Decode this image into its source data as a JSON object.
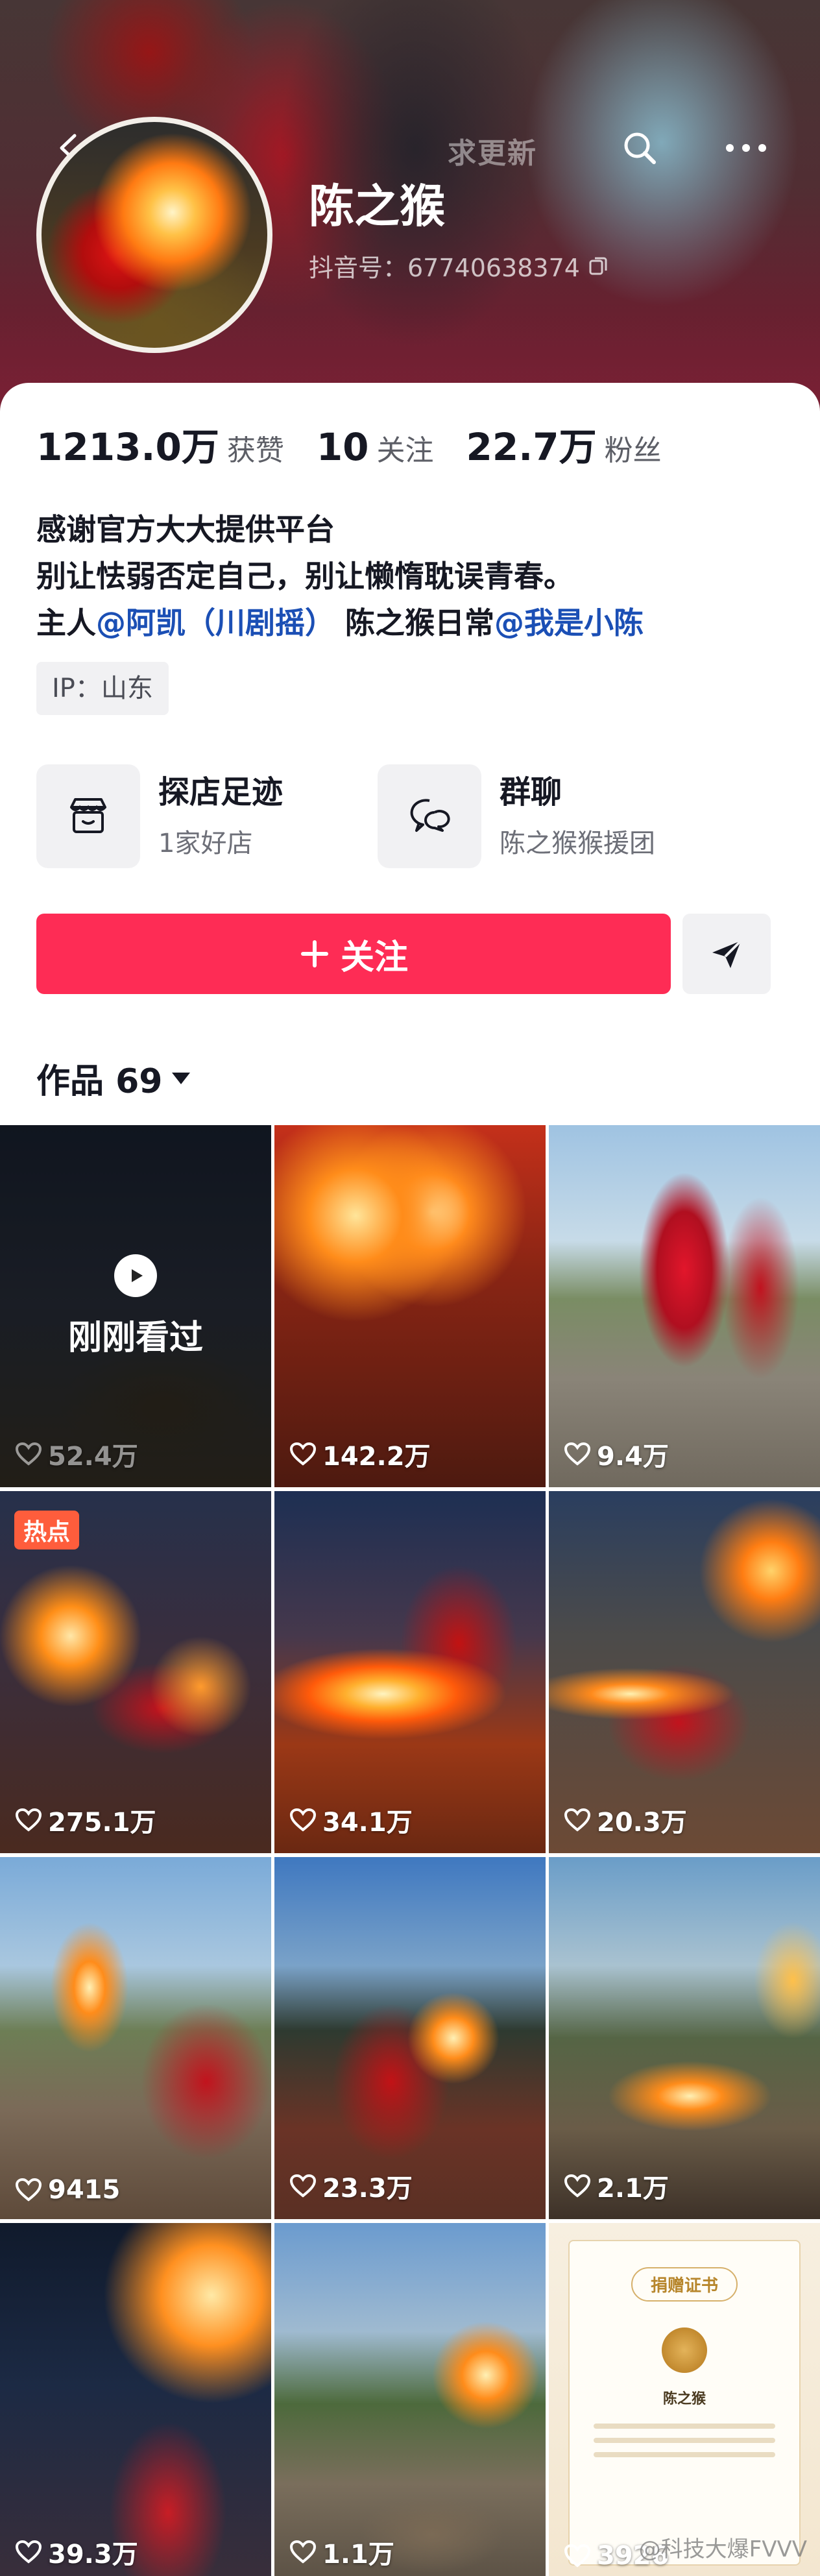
{
  "header": {
    "ghost_text": "求更新",
    "name": "陈之猴",
    "douyin_id": "抖音号：67740638374"
  },
  "stats": {
    "likes_value": "1213.0万",
    "likes_label": "获赞",
    "following_value": "10",
    "following_label": "关注",
    "fans_value": "22.7万",
    "fans_label": "粉丝"
  },
  "bio": {
    "line1": "感谢官方大大提供平台",
    "line2": "别让怯弱否定自己，别让懒惰耽误青春。",
    "line3_prefix": "主人",
    "mention1": "@阿凯（川剧摇）",
    "line3_middle": " 陈之猴日常",
    "mention2": "@我是小陈"
  },
  "ip_tag": "IP：山东",
  "entries": [
    {
      "title": "探店足迹",
      "sub": "1家好店"
    },
    {
      "title": "群聊",
      "sub": "陈之猴猴援团"
    }
  ],
  "follow_button": "关注",
  "works_tab": "作品 69",
  "videos": [
    {
      "likes": "52.4万",
      "watched_label": "刚刚看过",
      "scene": "s1"
    },
    {
      "likes": "142.2万",
      "scene": "s2"
    },
    {
      "likes": "9.4万",
      "scene": "s3"
    },
    {
      "likes": "275.1万",
      "badge": "热点",
      "scene": "s4"
    },
    {
      "likes": "34.1万",
      "scene": "s5"
    },
    {
      "likes": "20.3万",
      "scene": "s6"
    },
    {
      "likes": "9415",
      "scene": "s7"
    },
    {
      "likes": "23.3万",
      "scene": "s8"
    },
    {
      "likes": "2.1万",
      "scene": "s9"
    },
    {
      "likes": "39.3万",
      "scene": "s10"
    },
    {
      "likes": "1.1万",
      "scene": "s11"
    },
    {
      "likes": "3926",
      "scene": "s12",
      "certificate": {
        "title": "捐赠证书",
        "name": "陈之猴"
      }
    }
  ],
  "watermark": "@科技大爆FVVV",
  "colors": {
    "accent": "#fe2c55",
    "mention": "#1b4fb5"
  },
  "icons": [
    "back-arrow-icon",
    "search-icon",
    "more-icon",
    "copy-icon",
    "store-icon",
    "chat-icon",
    "plus-icon",
    "share-icon",
    "dropdown-triangle-icon",
    "heart-icon",
    "play-icon"
  ]
}
